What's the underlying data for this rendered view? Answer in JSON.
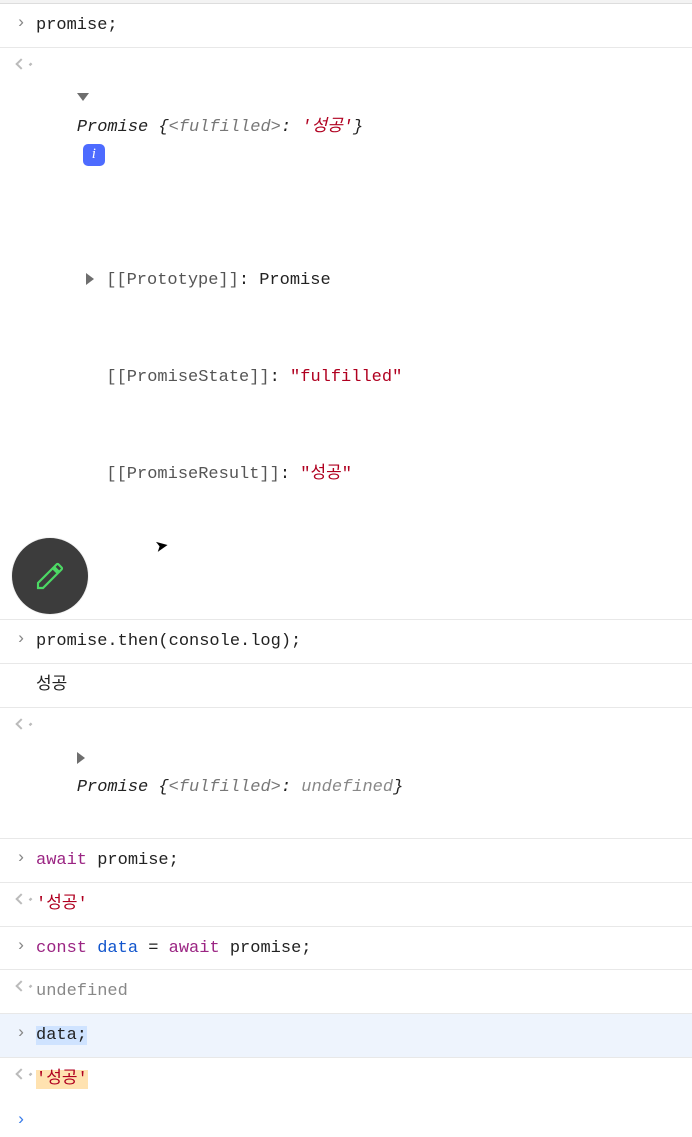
{
  "rows": {
    "r1_input": "promise;",
    "r2": {
      "type": "Promise",
      "state_label": "<fulfilled>",
      "value": "'성공'",
      "proto_label": "[[Prototype]]",
      "proto_value": "Promise",
      "state_key": "[[PromiseState]]",
      "state_value": "\"fulfilled\"",
      "result_key": "[[PromiseResult]]",
      "result_value": "\"성공\""
    },
    "r3_input": "promise.then(console.log);",
    "r4_log": "성공",
    "r5": {
      "type": "Promise",
      "state_label": "<fulfilled>",
      "value": "undefined"
    },
    "r6": {
      "kw": "await",
      "rest": " promise;"
    },
    "r7_out": "'성공'",
    "r8": {
      "kw1": "const",
      "ident": "data",
      "eq": " = ",
      "kw2": "await",
      "rest": " promise;"
    },
    "r9_out": "undefined",
    "r10_input": "data;",
    "r11_out": "'성공'"
  },
  "icons": {
    "info": "i"
  }
}
